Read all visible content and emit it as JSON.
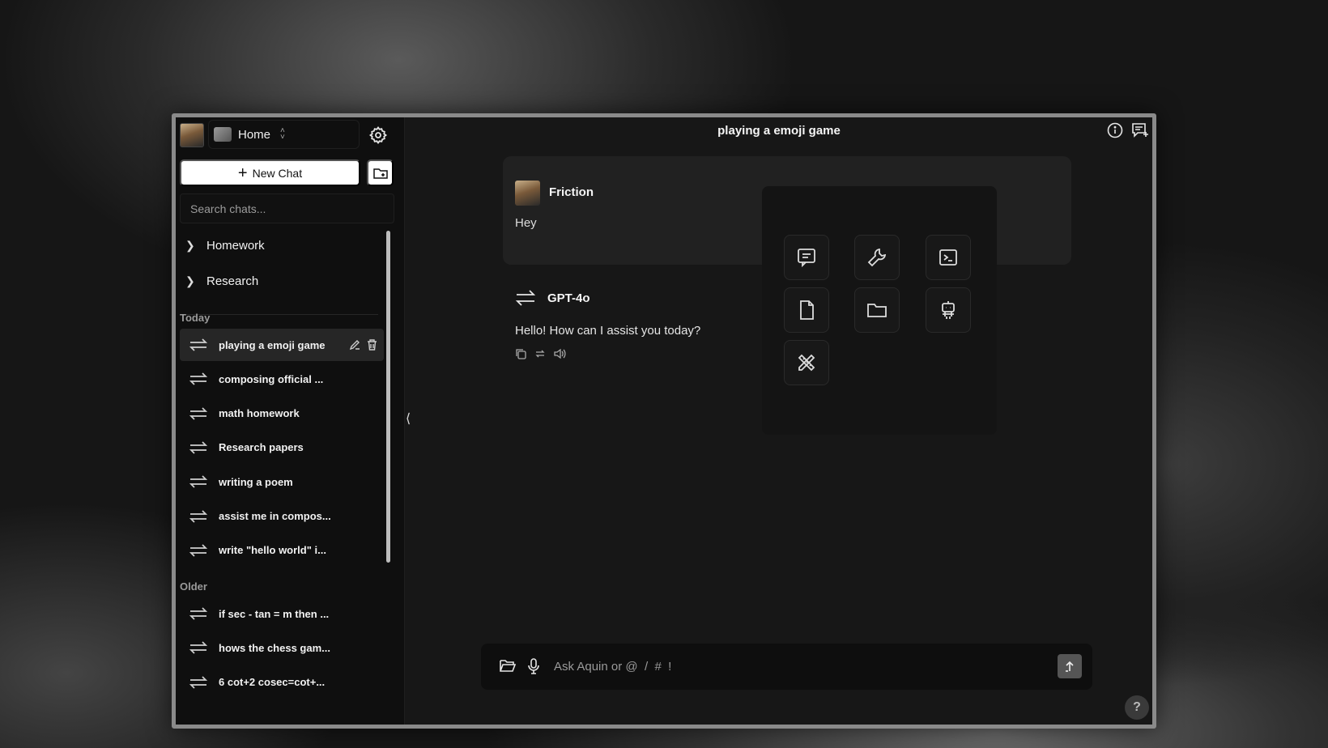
{
  "header": {
    "title": "playing a emoji game"
  },
  "sidebar": {
    "workspace": "Home",
    "new_chat_label": "New Chat",
    "search_placeholder": "Search chats...",
    "folders": [
      {
        "label": "Homework"
      },
      {
        "label": "Research"
      }
    ],
    "sections": {
      "today": "Today",
      "older": "Older"
    },
    "today_items": [
      {
        "label": "playing a emoji game"
      },
      {
        "label": "composing official ..."
      },
      {
        "label": "math homework"
      },
      {
        "label": "Research papers"
      },
      {
        "label": "writing a poem"
      },
      {
        "label": "assist me in compos..."
      },
      {
        "label": "write \"hello world\" i..."
      }
    ],
    "older_items": [
      {
        "label": "if sec - tan = m then ..."
      },
      {
        "label": "hows the chess gam..."
      },
      {
        "label": "6 cot+2 cosec=cot+..."
      }
    ]
  },
  "chat": {
    "user": {
      "name": "Friction",
      "text": "Hey"
    },
    "assistant": {
      "name": "GPT-4o",
      "text": "Hello! How can I assist you today?"
    }
  },
  "composer": {
    "placeholder": "Ask Aquin or @  /  #  !"
  },
  "help_label": "?",
  "colors": {
    "background": "#171717",
    "sidebar": "#0f0f0f",
    "accent": "#ffffff"
  }
}
